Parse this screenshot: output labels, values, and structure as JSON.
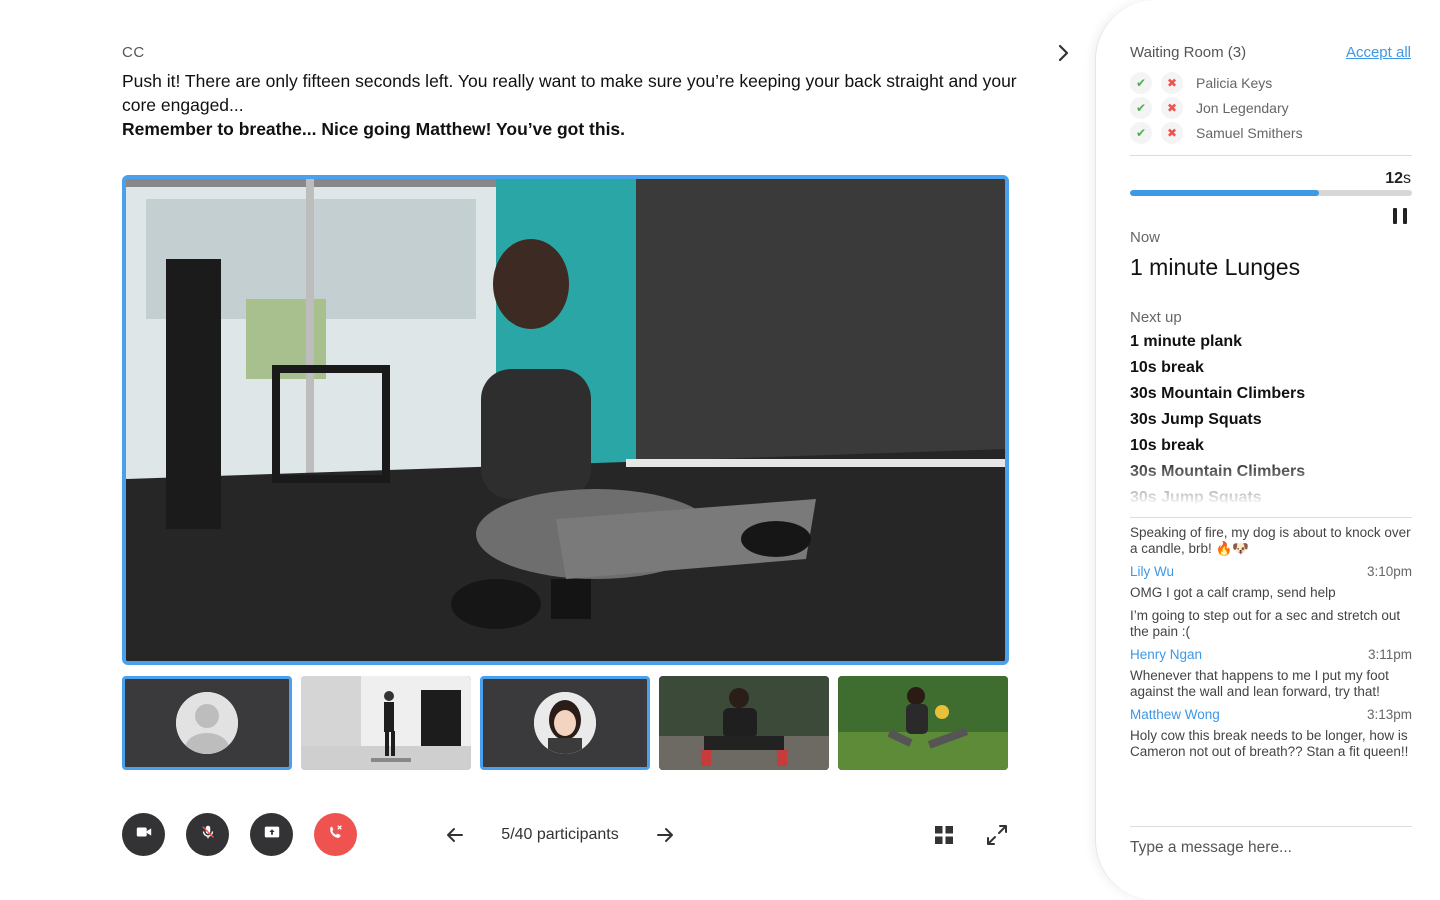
{
  "captions": {
    "label": "CC",
    "line1": "Push it! There are only fifteen seconds left. You really want to make sure you’re keeping your back straight and your core engaged...",
    "line2": "Remember to breathe... Nice going Matthew! You’ve got this."
  },
  "participants": {
    "count_label": "5/40 participants"
  },
  "waiting_room": {
    "title": "Waiting Room (3)",
    "accept_all": "Accept all",
    "people": [
      "Palicia Keys",
      "Jon Legendary",
      "Samuel Smithers"
    ]
  },
  "timer": {
    "value": "12",
    "unit": "s",
    "progress_fraction": 0.67
  },
  "workout": {
    "now_label": "Now",
    "now_title": "1 minute Lunges",
    "next_label": "Next up",
    "next_items": [
      "1 minute plank",
      "10s break",
      "30s Mountain Climbers",
      "30s Jump Squats",
      "10s break",
      "30s Mountain Climbers",
      "30s Jump Squats"
    ]
  },
  "chat": {
    "intro": "Speaking of fire, my dog is about to knock over a candle, brb! 🔥🐶",
    "messages": [
      {
        "user": "Lily Wu",
        "time": "3:10pm",
        "lines": [
          "OMG I got a calf cramp, send help",
          "I’m going to step out for a sec and stretch out the pain :("
        ]
      },
      {
        "user": "Henry Ngan",
        "time": "3:11pm",
        "lines": [
          "Whenever that happens to me I put my foot against the wall and lean forward, try that!"
        ]
      },
      {
        "user": "Matthew Wong",
        "time": "3:13pm",
        "lines": [
          "Holy cow this break needs to be longer, how is Cameron not out of breath?? Stan a fit queen!!"
        ]
      }
    ],
    "input_placeholder": "Type a message here..."
  },
  "colors": {
    "accent": "#3d98e6",
    "active_border": "#4aa0ec",
    "end_call": "#ef5350",
    "control_bg": "#333335",
    "accept": "#4caf50",
    "reject": "#ef5350"
  },
  "icons": {
    "cc_toggle": "chevron-right-icon",
    "camera": "video-camera-icon",
    "mic": "microphone-muted-icon",
    "share": "screen-share-icon",
    "end": "end-call-icon",
    "prev": "arrow-left-icon",
    "next": "arrow-right-icon",
    "grid": "grid-view-icon",
    "fullscreen": "fullscreen-icon",
    "pause": "pause-icon"
  }
}
